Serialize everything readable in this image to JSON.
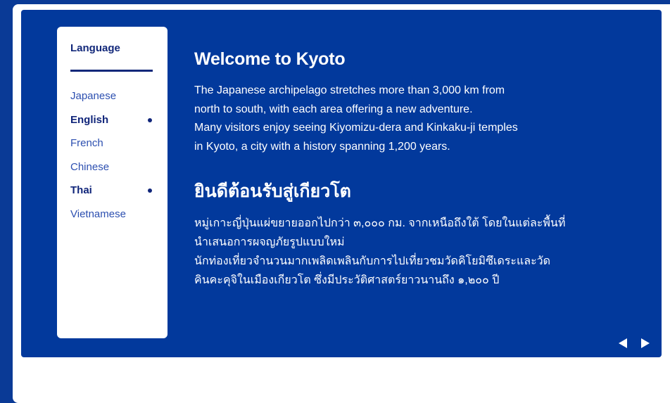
{
  "sidebar": {
    "heading": "Language",
    "languages": [
      {
        "label": "Japanese",
        "active": false
      },
      {
        "label": "English",
        "active": true
      },
      {
        "label": "French",
        "active": false
      },
      {
        "label": "Chinese",
        "active": false
      },
      {
        "label": "Thai",
        "active": true
      },
      {
        "label": "Vietnamese",
        "active": false
      }
    ]
  },
  "content": {
    "english": {
      "title": "Welcome to Kyoto",
      "body": "The Japanese archipelago stretches more than 3,000 km from\nnorth to south, with each area offering a new adventure.\nMany visitors enjoy seeing Kiyomizu-dera and Kinkaku-ji temples\nin Kyoto, a city with a history spanning 1,200 years."
    },
    "thai": {
      "title": "ยินดีต้อนรับสู่เกียวโต",
      "body": "หมู่เกาะญี่ปุ่นแผ่ขยายออกไปกว่า ๓,๐๐๐ กม. จากเหนือถึงใต้ โดยในแต่ละพื้นที่\nนำเสนอการผจญภัยรูปแบบใหม่\nนักท่องเที่ยวจำนวนมากเพลิดเพลินกับการไปเที่ยวชมวัดคิโยมิซึเดระและวัด\nคินคะคุจิในเมืองเกียวโต ซึ่งมีประวัติศาสตร์ยาวนานถึง ๑,๒๐๐ ปี"
    }
  },
  "colors": {
    "background": "#0a3a96",
    "panel": "#02399c",
    "card": "#ffffff",
    "accent_text": "#10257a",
    "link_text": "#2c4fb0"
  },
  "icons": {
    "prev": "triangle-left-icon",
    "next": "triangle-right-icon"
  }
}
